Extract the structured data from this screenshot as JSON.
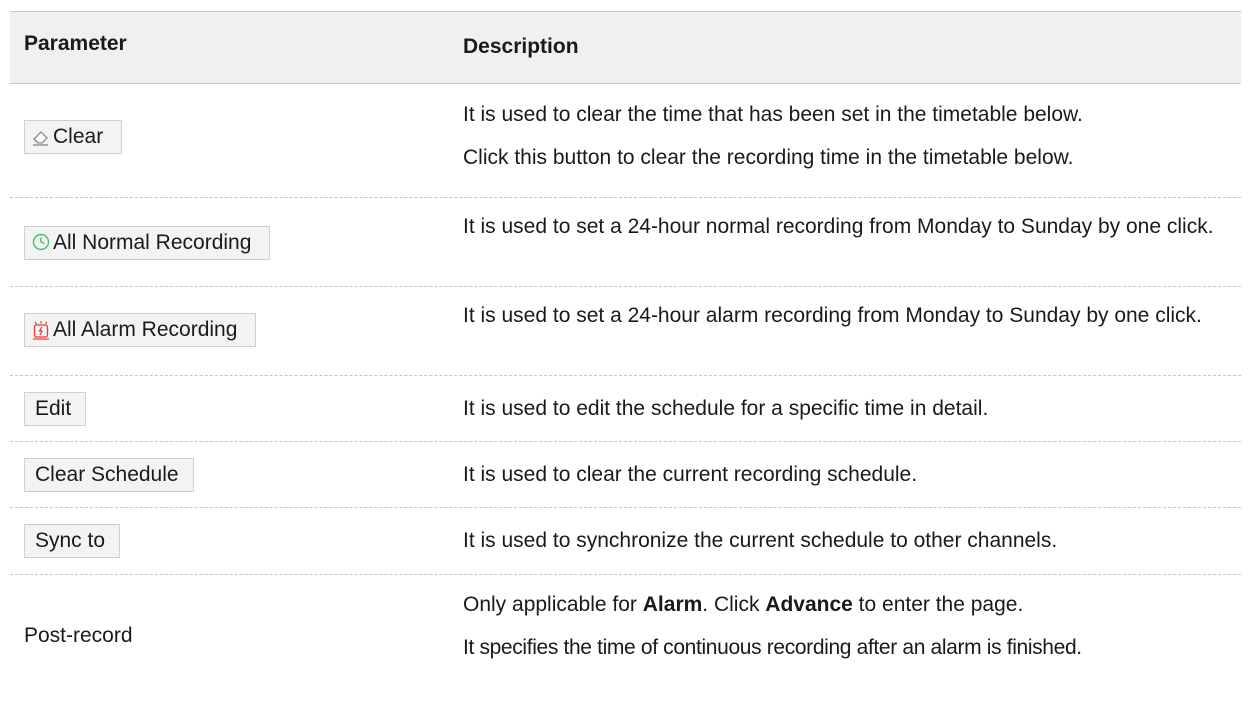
{
  "table": {
    "header": {
      "parameter": "Parameter",
      "description": "Description"
    },
    "rows": [
      {
        "param": "Clear",
        "icon": "eraser-icon",
        "desc1": "It is used to clear the time that has been set in the timetable below.",
        "desc2": "Click this button to clear the recording time in the timetable below."
      },
      {
        "param": "All Normal Recording",
        "icon": "clock-icon",
        "desc1": "It is used to set a 24-hour normal recording from Monday to Sunday by one click."
      },
      {
        "param": "All Alarm Recording",
        "icon": "alarm-clock-icon",
        "desc1": "It is used to set a 24-hour alarm recording from Monday to Sunday by one click."
      },
      {
        "param": "Edit",
        "desc1": "It is used to edit the schedule for a specific time in detail."
      },
      {
        "param": "Clear Schedule",
        "desc1": "It is used to clear the current recording schedule."
      },
      {
        "param": "Sync to",
        "desc1": "It is used to synchronize the current schedule to other channels."
      },
      {
        "param": "Post-record",
        "desc1_pre": "Only applicable for ",
        "desc1_b1": "Alarm",
        "desc1_mid": ". Click ",
        "desc1_b2": "Advance",
        "desc1_post": " to enter the page.",
        "desc2": "It specifies the time of continuous recording after an alarm is finished."
      }
    ]
  },
  "colors": {
    "header_bg": "#f0f0f0",
    "button_bg": "#f3f3f3",
    "clock_green": "#3fc46a",
    "alarm_red": "#e23c3c"
  }
}
